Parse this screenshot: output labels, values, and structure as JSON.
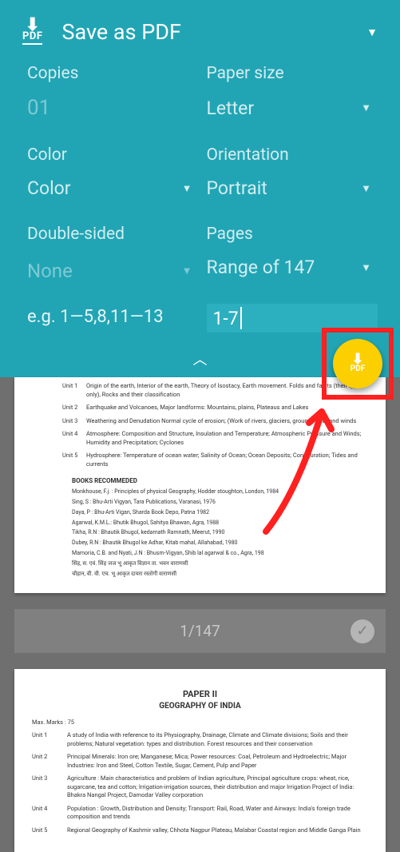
{
  "header": {
    "title": "Save as PDF",
    "pdf_icon_label": "PDF"
  },
  "options": {
    "copies_label": "Copies",
    "copies_value": "01",
    "paper_size_label": "Paper size",
    "paper_size_value": "Letter",
    "color_label": "Color",
    "color_value": "Color",
    "orientation_label": "Orientation",
    "orientation_value": "Portrait",
    "double_label": "Double-sided",
    "double_value": "None",
    "pages_label": "Pages",
    "pages_value": "Range of 147",
    "example_text": "e.g. 1—5,8,11—13",
    "range_input": "1-7"
  },
  "page_counter": "1/147",
  "fab_label": "PDF",
  "preview1": {
    "unit1_label": "Unit 1",
    "unit1_text": "Origin of the earth, Interior of the earth, Theory of Isostacy, Earth movement. Folds and faults (their types only), Rocks and their classification",
    "unit2_label": "Unit 2",
    "unit2_text": "Earthquake and Volcanoes, Major landforms: Mountains, plains, Plateaus and Lakes",
    "unit3_label": "Unit 3",
    "unit3_text": "Weathering and Denudation Normal cycle of erosion; (Work of rivers, glaciers, ground water and winds",
    "unit4_label": "Unit 4",
    "unit4_text": "Atmosphere: Composition and Structure, Insulation and Temperature; Atmospheric Pressure and Winds; Humidity and Precipitation; Cyclones",
    "unit5_label": "Unit 5",
    "unit5_text": "Hydrosphere: Temperature of ocean water; Salinity of Ocean; Ocean Deposits; Configuration; Tides and currents",
    "books_title": "BOOKS RECOMMEDED",
    "b1": "Monkhouse, F.j. : Principles of physical Geography, Hodder stoughton, London, 1984",
    "b2": "Sing, S : Bhu-Arti Vigyan, Tara Publications, Varanasi, 1976",
    "b3": "Daya, P : Bhu-Arti Vigan, Sharda Book Depo, Patna 1982",
    "b4": "Agarwal, K.M.L.: Bhutik Bhugol, Sahitya Bhawan, Agra, 1988",
    "b5": "Tikha, R.N : Bhautik Bhugol, kedarnath Ramnath, Meerut, 1990",
    "b6": "Dubey, R.N : Bhautik Bhugol ke Adhar, Kitab mahal, Allahabad, 1980",
    "b7": "Mamoria, C.B. and Nyati, J.N : Bhusm-Vigyan, Shib lal agarwal & co., Agra, 198",
    "b8": "सिंह, स. एवं. सिंह जज भू आकृत विज्ञान ता. भवन वाराणसी",
    "b9": "चौहान, वी. वी. एच. भू आकृत दायरा रस्तोगी वाराणसी"
  },
  "preview2": {
    "title": "PAPER II",
    "subtitle": "GEOGRAPHY OF INDIA",
    "marks": "Max. Marks : 75",
    "u1_label": "Unit 1",
    "u1_text": "A study of India with reference to its Physiography, Drainage, Climate and Climate divisions; Soils and their problems; Natural vegetation: types and distribution. Forest resources and their conservation",
    "u2_label": "Unit 2",
    "u2_text": "Principal Minerals: Iron ore; Manganese; Mica; Power resources: Coal, Petroleum and Hydroelectric; Major Industries: Iron and Steel, Cotton Textile, Sugar, Cement, Pulp and Paper",
    "u3_label": "Unit 3",
    "u3_text": "Agriculture : Main characteristics and problem of Indian agriculture, Principal agriculture crops: wheat, rice, sugarcane, tea and cotton; Irrigation-irrigation sources, their distribution and major Irrigation Project of India: Bhakra Nangal Project, Damodar Valley corporation",
    "u4_label": "Unit 4",
    "u4_text": "Population : Growth, Distribution and Density; Transport: Rail, Road, Water and Airways: India's foreign trade composition and trends",
    "u5_label": "Unit 5",
    "u5_text": "Regional Geography of Kashmir valley, Chhota Nagpur Plateau, Malabar Coastal region and Middle Ganga Plain"
  }
}
